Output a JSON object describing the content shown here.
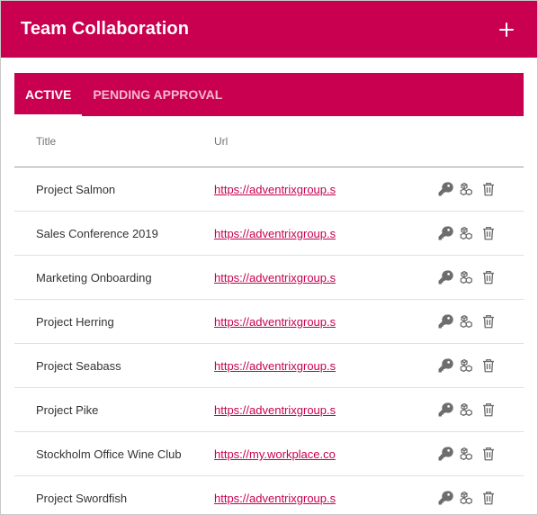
{
  "header": {
    "title": "Team Collaboration",
    "add_icon": "plus-icon"
  },
  "tabs": [
    {
      "label": "ACTIVE",
      "active": true
    },
    {
      "label": "PENDING APPROVAL",
      "active": false
    }
  ],
  "table": {
    "columns": {
      "title": "Title",
      "url": "Url"
    },
    "rows": [
      {
        "title": "Project Salmon",
        "url": "https://adventrixgroup.s"
      },
      {
        "title": "Sales Conference 2019",
        "url": "https://adventrixgroup.s"
      },
      {
        "title": "Marketing Onboarding",
        "url": "https://adventrixgroup.s"
      },
      {
        "title": "Project Herring",
        "url": "https://adventrixgroup.s"
      },
      {
        "title": "Project Seabass",
        "url": "https://adventrixgroup.s"
      },
      {
        "title": "Project Pike",
        "url": "https://adventrixgroup.s"
      },
      {
        "title": "Stockholm Office Wine Club",
        "url": "https://my.workplace.co"
      },
      {
        "title": "Project Swordfish",
        "url": "https://adventrixgroup.s"
      }
    ],
    "row_actions": [
      "key-icon",
      "cubes-icon",
      "trash-icon"
    ]
  },
  "colors": {
    "brand": "#c8004f",
    "tab_inactive_text": "#f6b8d0",
    "icon_gray": "#6d6d6d"
  }
}
